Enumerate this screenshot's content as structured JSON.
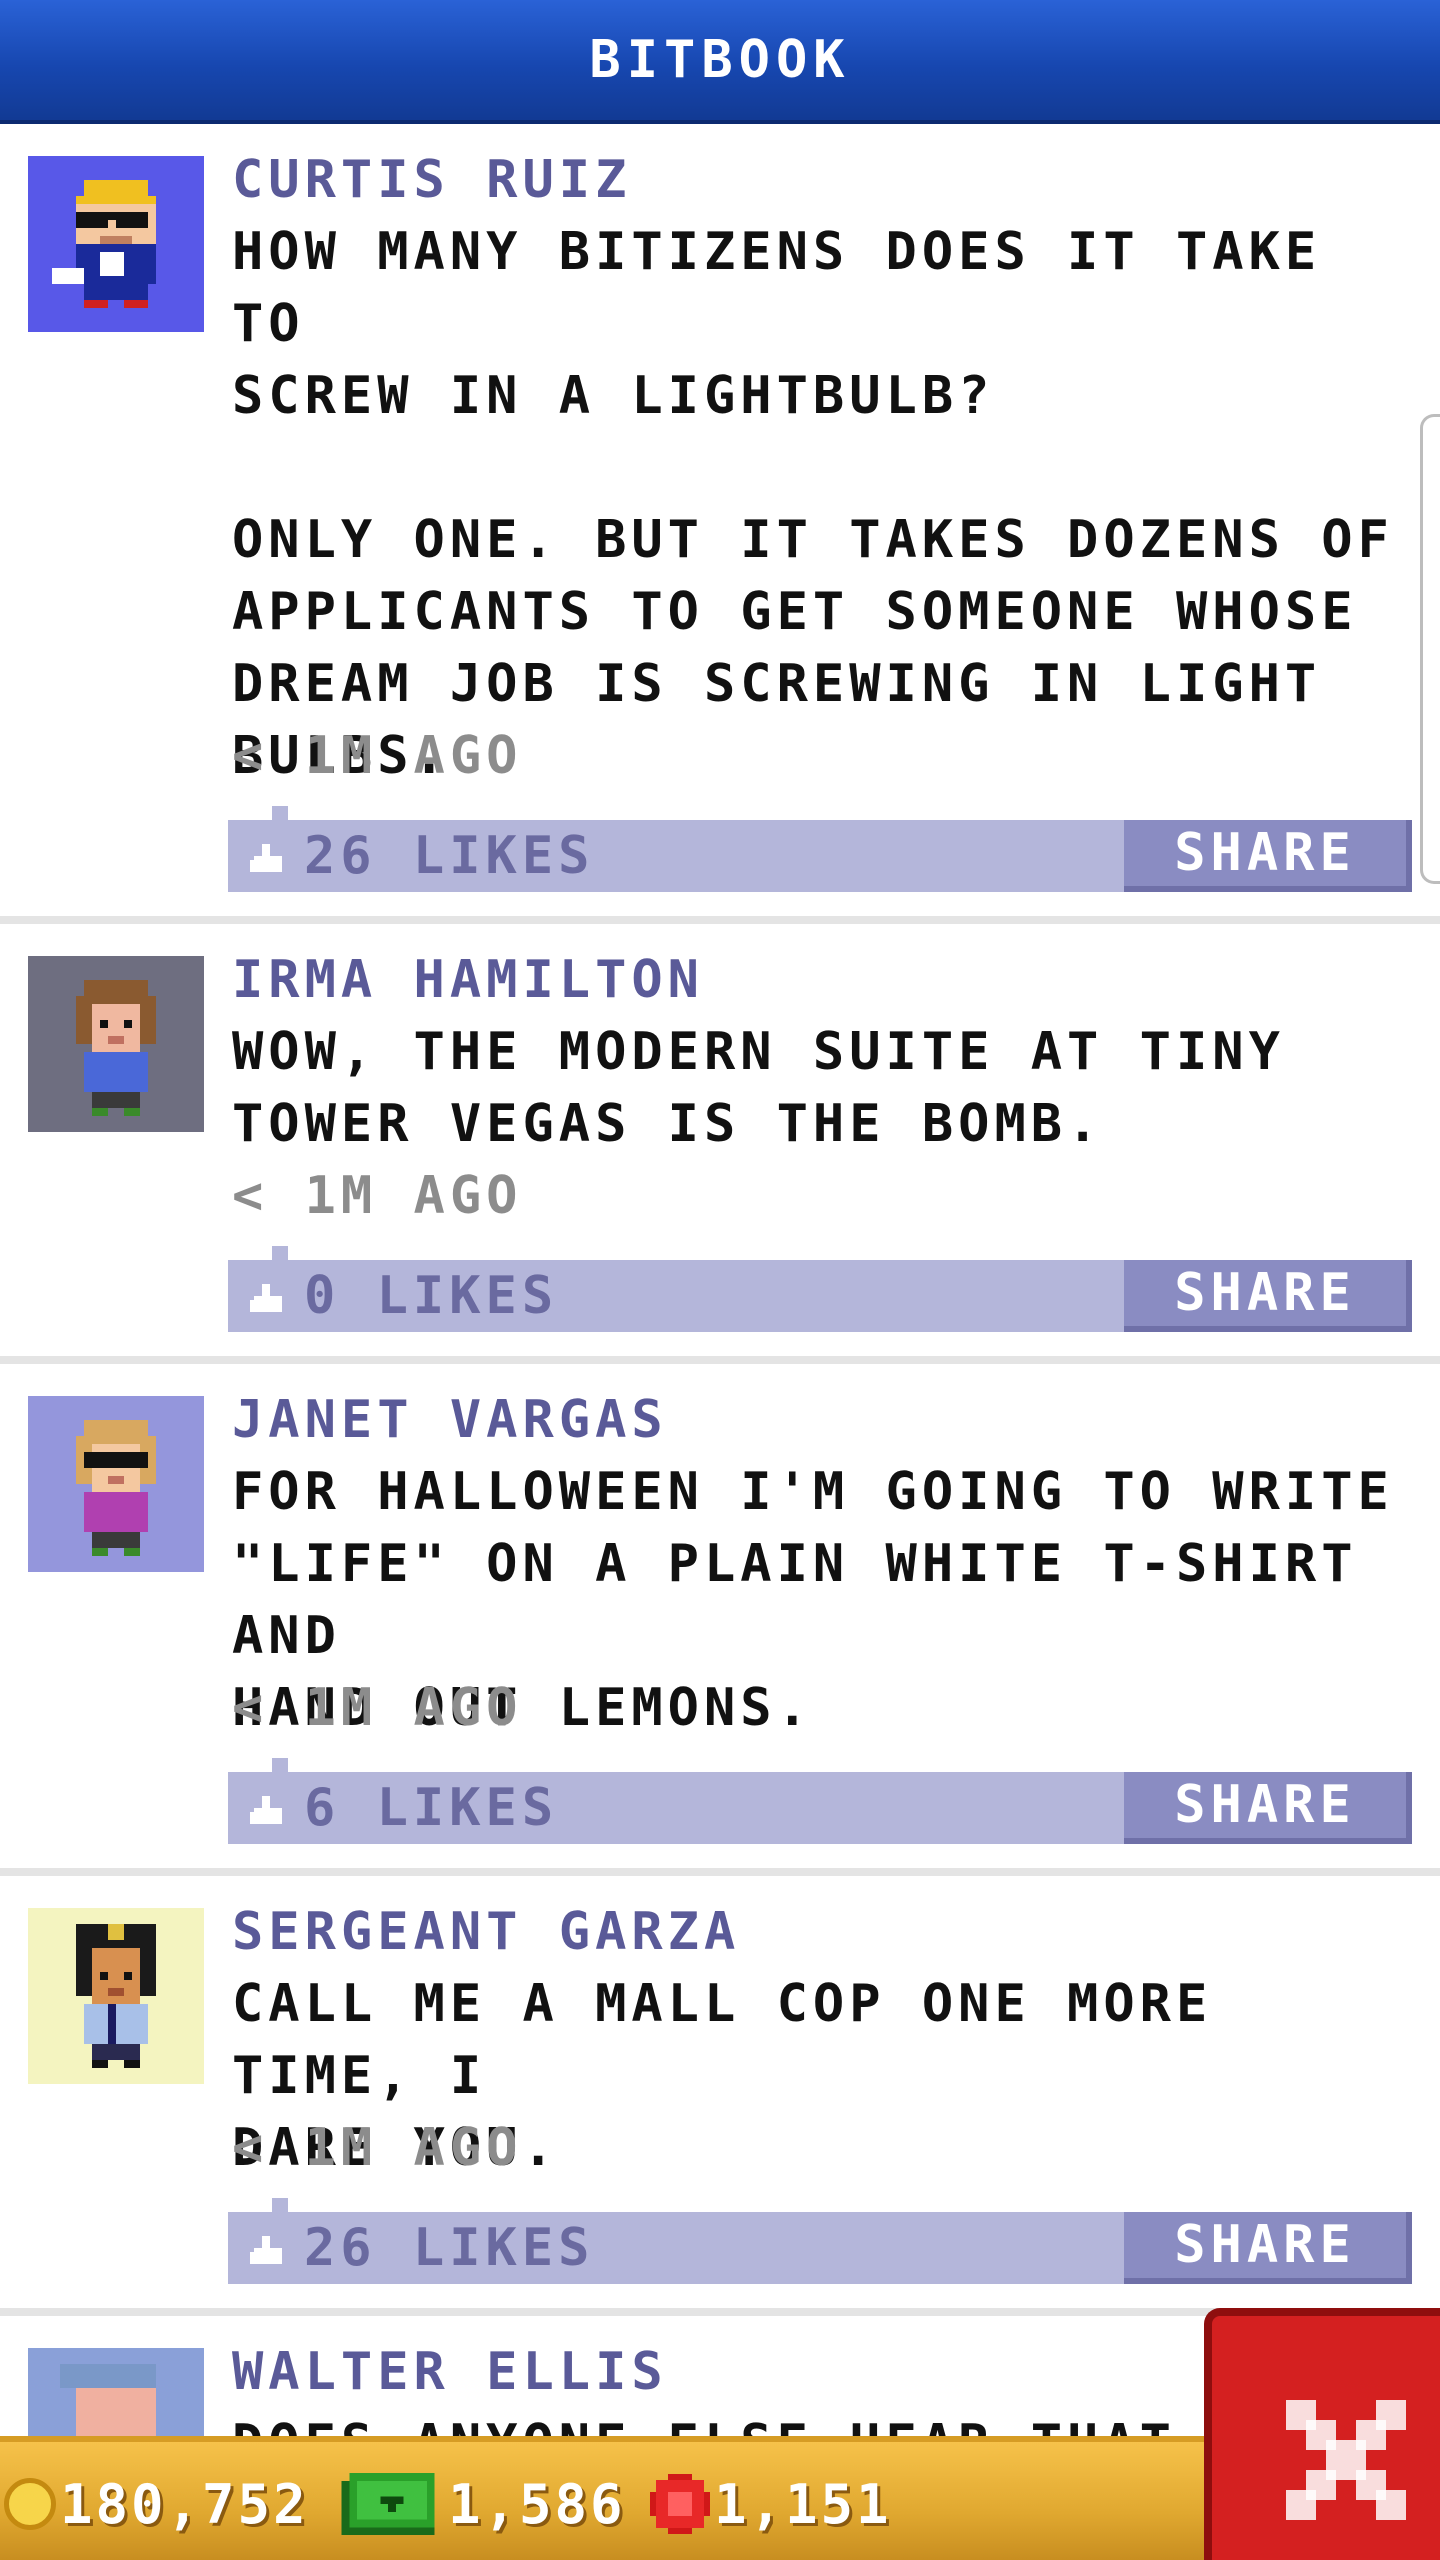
{
  "header": {
    "title": "BITBOOK"
  },
  "colors": {
    "header_blue": "#1747b0",
    "name_purple": "#5a5a98",
    "likes_bar": "#b4b6da",
    "share_button": "#8a8cc2",
    "bottom_bar_gold": "#e0a830",
    "close_red": "#d42020"
  },
  "posts": [
    {
      "author": "CURTIS RUIZ",
      "text": "HOW MANY BITIZENS DOES IT TAKE TO\nSCREW IN A LIGHTBULB?\n\nONLY ONE. BUT IT TAKES DOZENS OF\nAPPLICANTS TO GET SOMEONE WHOSE\nDREAM JOB IS SCREWING IN LIGHT\nBULBS.",
      "time": "< 1M AGO",
      "likes": "26 LIKES",
      "share": "SHARE",
      "avatar_bg": "#5858e8"
    },
    {
      "author": "IRMA HAMILTON",
      "text": "WOW, THE MODERN SUITE AT TINY\nTOWER VEGAS IS THE BOMB.",
      "time": "< 1M AGO",
      "likes": "0 LIKES",
      "share": "SHARE",
      "avatar_bg": "#6e6e80"
    },
    {
      "author": "JANET VARGAS",
      "text": "FOR HALLOWEEN I'M GOING TO WRITE\n\"LIFE\" ON A PLAIN WHITE T-SHIRT AND\nHAND OUT LEMONS.",
      "time": "< 1M AGO",
      "likes": "6 LIKES",
      "share": "SHARE",
      "avatar_bg": "#9496dc"
    },
    {
      "author": "SERGEANT GARZA",
      "text": "CALL ME A MALL COP ONE MORE TIME, I\nDARE YOU.",
      "time": "< 1M AGO",
      "likes": "26 LIKES",
      "share": "SHARE",
      "avatar_bg": "#f4f4c0"
    },
    {
      "author": "WALTER ELLIS",
      "text": "DOES ANYONE ELSE HEAR THAT",
      "avatar_bg": "#8aa0d8"
    }
  ],
  "currency": {
    "coins": "180,752",
    "bux": "1,586",
    "tokens": "1,151"
  },
  "icons": {
    "coin": "coin-icon",
    "bux": "bux-icon",
    "token": "gem-icon",
    "like": "thumbs-up-icon",
    "close": "close-icon"
  }
}
